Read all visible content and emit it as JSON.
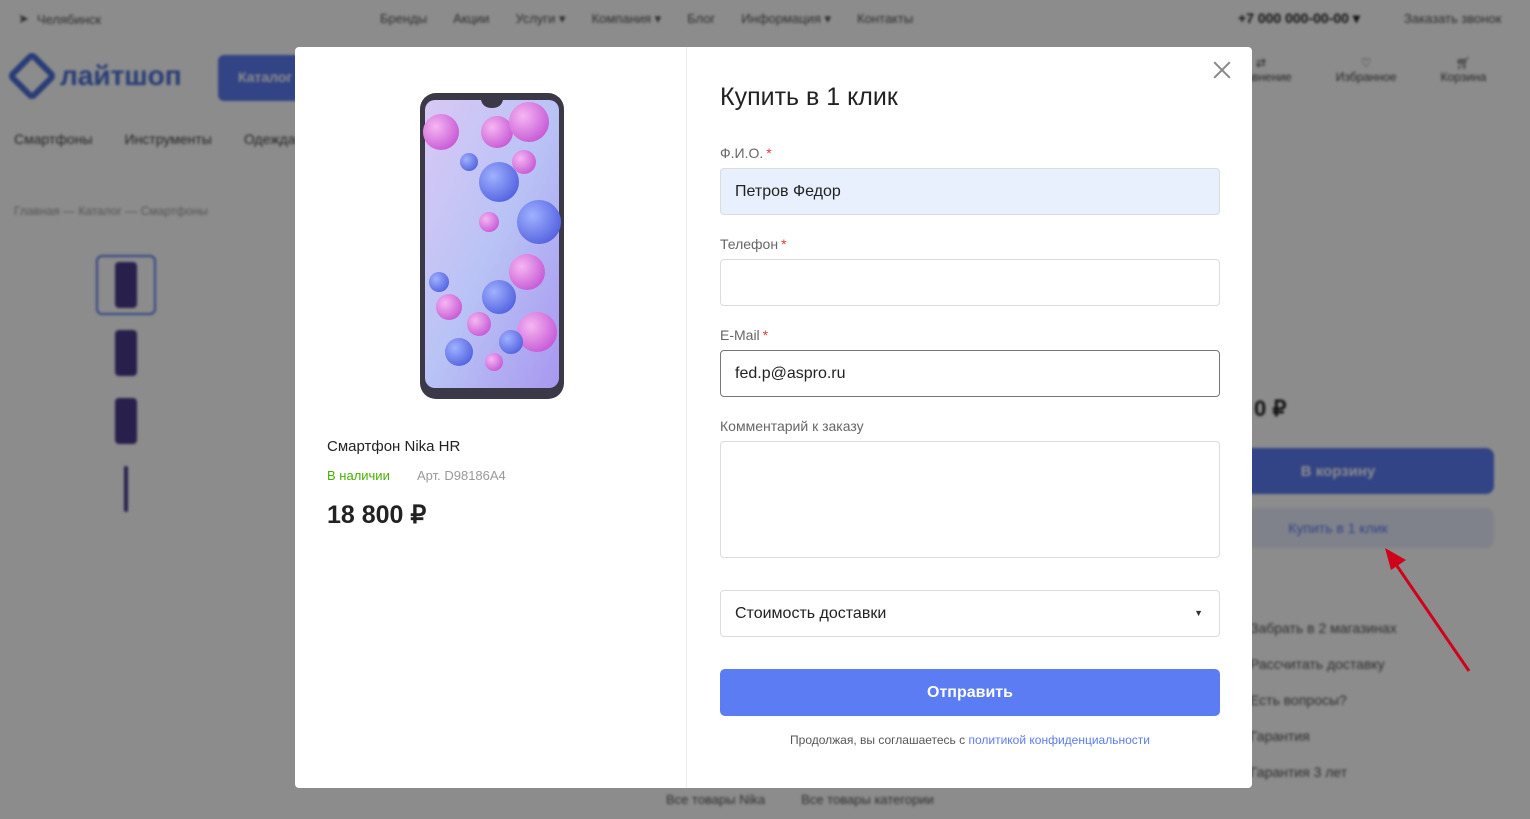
{
  "background": {
    "city": "Челябинск",
    "nav": [
      "Бренды",
      "Акции",
      "Услуги ▾",
      "Компания ▾",
      "Блог",
      "Информация ▾",
      "Контакты"
    ],
    "phone": "+7 000 000-00-00 ▾",
    "callback": "Заказать звонок",
    "logo": "лайтшоп",
    "catalog_label": "Каталог",
    "header_icons": [
      {
        "icon": "compare-icon",
        "label": "Сравнение"
      },
      {
        "icon": "heart-icon",
        "label": "Избранное"
      },
      {
        "icon": "cart-icon",
        "label": "Корзина"
      }
    ],
    "categories": [
      "Смартфоны",
      "Инструменты",
      "Одежда"
    ],
    "breadcrumbs": "Главная — Каталог — Смартфоны",
    "price_partial": "0 ₽",
    "cart_button": "В корзину",
    "one_click_button": "Купить в 1 клик",
    "info_list": [
      "Забрать в 2 магазинах",
      "Рассчитать доставку",
      "Есть вопросы?",
      "Гарантия",
      "Гарантия 3 лет"
    ],
    "bottom_links": [
      "Все товары Nika",
      "Все товары категории"
    ]
  },
  "product": {
    "name": "Смартфон Nika HR",
    "stock": "В наличии",
    "sku": "Арт. D98186A4",
    "price": "18 800 ₽"
  },
  "form": {
    "title": "Купить в 1 клик",
    "fio_label": "Ф.И.О.",
    "fio_value": "Петров Федор",
    "phone_label": "Телефон",
    "phone_value": "",
    "email_label": "E-Mail",
    "email_value": "fed.p@aspro.ru",
    "comment_label": "Комментарий к заказу",
    "comment_value": "",
    "required_mark": "*",
    "delivery_select": "Стоимость доставки",
    "submit_label": "Отправить",
    "consent_text": "Продолжая, вы соглашаетесь с",
    "consent_link": "политикой конфиденциальности"
  },
  "colors": {
    "accent": "#5b7cf2",
    "in_stock": "#47b100",
    "required": "#e53935",
    "arrow": "#d0021b"
  }
}
